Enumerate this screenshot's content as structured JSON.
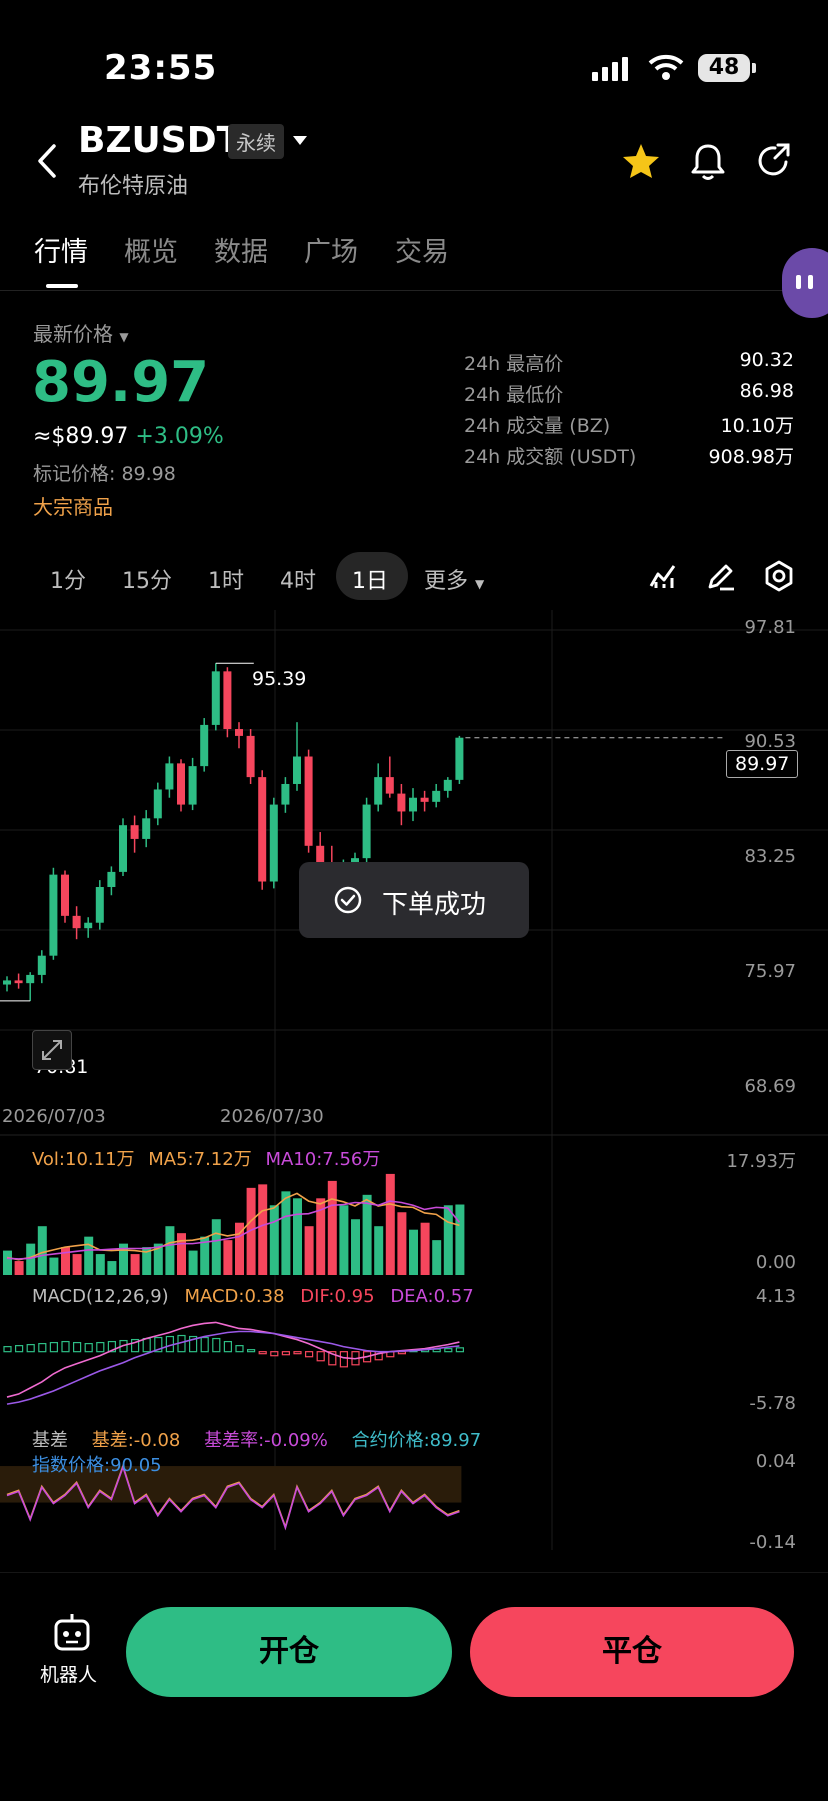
{
  "status_bar": {
    "time": "23:55",
    "battery": "48"
  },
  "header": {
    "symbol": "BZUSDT",
    "contract_type": "永续",
    "name": "布伦特原油"
  },
  "tabs": [
    "行情",
    "概览",
    "数据",
    "广场",
    "交易"
  ],
  "ticker": {
    "price_label": "最新价格",
    "last_price": "89.97",
    "usd_price": "≈$89.97",
    "change": "+3.09%",
    "mark_price": "标记价格: 89.98",
    "category": "大宗商品",
    "stats": [
      {
        "label": "24h 最高价",
        "value": "90.32"
      },
      {
        "label": "24h 最低价",
        "value": "86.98"
      },
      {
        "label": "24h 成交量 (BZ)",
        "value": "10.10万"
      },
      {
        "label": "24h 成交额 (USDT)",
        "value": "908.98万"
      }
    ]
  },
  "intervals": [
    "1分",
    "15分",
    "1时",
    "4时",
    "1日",
    "更多"
  ],
  "chart": {
    "y_ticks": [
      "97.81",
      "90.53",
      "83.25",
      "75.97",
      "68.69"
    ],
    "high_label": "95.39",
    "low_label": "70.81",
    "current_price_tag": "89.97",
    "x_labels": [
      "2026/07/03",
      "2026/07/30"
    ]
  },
  "volume": {
    "vol": "Vol:10.11万",
    "ma5": "MA5:7.12万",
    "ma10": "MA10:7.56万",
    "max": "17.93万",
    "min": "0.00"
  },
  "macd": {
    "title": "MACD(12,26,9)",
    "macd": "MACD:0.38",
    "dif": "DIF:0.95",
    "dea": "DEA:0.57",
    "max": "4.13",
    "min": "-5.78"
  },
  "basis": {
    "title": "基差",
    "basis": "基差:-0.08",
    "rate": "基差率:-0.09%",
    "contract": "合约价格:89.97",
    "index": "指数价格:90.05",
    "max": "0.04",
    "min": "-0.14"
  },
  "toast": "下单成功",
  "bottom": {
    "robot": "机器人",
    "open": "开仓",
    "close": "平仓"
  },
  "colors": {
    "up": "#2ebd85",
    "down": "#f6465d",
    "bg": "#000000"
  },
  "chart_data": {
    "type": "candlestick",
    "ylim": [
      68.69,
      97.81
    ],
    "high": 95.39,
    "low": 70.81,
    "last": 89.97,
    "candles": [
      [
        72.0,
        72.6,
        71.5,
        72.3
      ],
      [
        72.3,
        72.8,
        71.7,
        72.1
      ],
      [
        72.1,
        72.9,
        70.81,
        72.7
      ],
      [
        72.7,
        74.5,
        72.1,
        74.1
      ],
      [
        74.1,
        80.5,
        73.8,
        80.0
      ],
      [
        80.0,
        80.3,
        76.5,
        77.0
      ],
      [
        77.0,
        77.7,
        75.3,
        76.1
      ],
      [
        76.1,
        76.9,
        75.4,
        76.5
      ],
      [
        76.5,
        79.6,
        76.0,
        79.1
      ],
      [
        79.1,
        80.6,
        78.5,
        80.2
      ],
      [
        80.2,
        84.1,
        79.9,
        83.6
      ],
      [
        83.6,
        84.3,
        81.6,
        82.6
      ],
      [
        82.6,
        84.7,
        82.0,
        84.1
      ],
      [
        84.1,
        86.7,
        83.6,
        86.2
      ],
      [
        86.2,
        88.6,
        85.6,
        88.1
      ],
      [
        88.1,
        88.4,
        84.6,
        85.1
      ],
      [
        85.1,
        88.5,
        84.7,
        87.9
      ],
      [
        87.9,
        91.4,
        87.5,
        90.9
      ],
      [
        90.9,
        95.39,
        90.5,
        94.8
      ],
      [
        94.8,
        95.1,
        90.0,
        90.6
      ],
      [
        90.6,
        91.1,
        89.2,
        90.1
      ],
      [
        90.1,
        90.6,
        86.6,
        87.1
      ],
      [
        87.1,
        87.6,
        78.9,
        79.5
      ],
      [
        79.5,
        85.6,
        79.0,
        85.1
      ],
      [
        85.1,
        87.1,
        84.5,
        86.6
      ],
      [
        86.6,
        91.1,
        86.1,
        88.6
      ],
      [
        88.6,
        89.1,
        81.6,
        82.1
      ],
      [
        82.1,
        83.1,
        80.1,
        80.6
      ],
      [
        80.6,
        82.1,
        77.6,
        78.2
      ],
      [
        78.2,
        81.1,
        77.9,
        80.6
      ],
      [
        80.6,
        81.6,
        80.1,
        81.2
      ],
      [
        81.2,
        85.6,
        80.9,
        85.1
      ],
      [
        85.1,
        88.1,
        84.6,
        87.1
      ],
      [
        87.1,
        88.6,
        85.6,
        85.9
      ],
      [
        85.9,
        86.6,
        83.6,
        84.6
      ],
      [
        84.6,
        86.3,
        83.9,
        85.6
      ],
      [
        85.6,
        86.1,
        84.6,
        85.3
      ],
      [
        85.3,
        86.6,
        84.9,
        86.1
      ],
      [
        86.1,
        87.1,
        85.6,
        86.9
      ],
      [
        86.9,
        90.1,
        86.6,
        89.97
      ]
    ],
    "volume": [
      3.5,
      2.0,
      4.5,
      7.0,
      2.5,
      4.0,
      3.0,
      5.5,
      3.0,
      2.0,
      4.5,
      3.0,
      4.0,
      4.5,
      7.0,
      6.0,
      3.5,
      5.5,
      8.0,
      5.0,
      7.5,
      12.5,
      13.0,
      10.0,
      12.0,
      11.0,
      7.0,
      11.0,
      13.5,
      10.0,
      8.0,
      11.5,
      7.0,
      14.5,
      9.0,
      6.5,
      7.5,
      5.0,
      10.0,
      10.11
    ],
    "ma5": [
      2.5,
      2.2,
      2.5,
      3.2,
      3.6,
      4.0,
      4.2,
      4.4,
      3.6,
      3.5,
      3.6,
      3.5,
      3.3,
      3.8,
      4.6,
      4.9,
      5.0,
      5.3,
      6.0,
      5.6,
      5.9,
      7.7,
      9.2,
      9.6,
      11.0,
      11.7,
      10.6,
      10.2,
      10.9,
      10.5,
      9.9,
      10.8,
      9.9,
      10.2,
      9.8,
      9.7,
      8.9,
      8.7,
      7.6,
      7.12
    ],
    "ma10": [
      2.4,
      2.3,
      2.4,
      2.8,
      3.0,
      3.2,
      3.4,
      3.6,
      3.6,
      3.7,
      3.8,
      3.8,
      3.8,
      4.0,
      4.3,
      4.5,
      4.5,
      4.7,
      4.9,
      5.2,
      5.5,
      6.4,
      7.1,
      7.6,
      8.4,
      8.7,
      8.8,
      9.3,
      10.0,
      10.1,
      10.4,
      10.3,
      10.0,
      10.6,
      10.4,
      10.0,
      9.4,
      9.7,
      9.6,
      7.56
    ],
    "macd_hist": [
      0.5,
      0.6,
      0.7,
      0.8,
      0.9,
      1.0,
      0.9,
      0.8,
      0.9,
      1.0,
      1.1,
      1.2,
      1.3,
      1.4,
      1.5,
      1.6,
      1.5,
      1.4,
      1.3,
      1.0,
      0.6,
      0.2,
      -0.2,
      -0.4,
      -0.3,
      -0.2,
      -0.5,
      -0.9,
      -1.3,
      -1.5,
      -1.3,
      -1.0,
      -0.8,
      -0.5,
      -0.2,
      0.1,
      0.2,
      0.25,
      0.3,
      0.38
    ],
    "dif": [
      -4.5,
      -4.2,
      -3.6,
      -3.0,
      -2.2,
      -1.6,
      -1.2,
      -0.8,
      -0.4,
      0.1,
      0.6,
      0.9,
      1.3,
      1.6,
      1.9,
      2.3,
      2.6,
      2.8,
      2.9,
      2.6,
      2.3,
      2.2,
      2.0,
      1.8,
      1.5,
      1.2,
      0.8,
      0.3,
      -0.2,
      -0.6,
      -0.7,
      -0.5,
      -0.2,
      0.0,
      0.1,
      0.2,
      0.3,
      0.5,
      0.7,
      0.95
    ],
    "dea": [
      -5.2,
      -5.0,
      -4.7,
      -4.3,
      -3.9,
      -3.4,
      -2.9,
      -2.4,
      -1.9,
      -1.5,
      -1.1,
      -0.6,
      -0.2,
      0.2,
      0.6,
      0.9,
      1.2,
      1.5,
      1.7,
      1.9,
      2.0,
      2.0,
      1.9,
      1.8,
      1.6,
      1.4,
      1.2,
      1.0,
      0.8,
      0.5,
      0.3,
      0.1,
      0.0,
      0.0,
      0.05,
      0.1,
      0.2,
      0.3,
      0.45,
      0.57
    ],
    "basis_rate": [
      -0.04,
      -0.03,
      -0.1,
      -0.02,
      -0.06,
      -0.04,
      -0.01,
      -0.07,
      -0.03,
      -0.05,
      0.03,
      -0.06,
      -0.04,
      -0.09,
      -0.05,
      -0.08,
      -0.05,
      -0.04,
      -0.07,
      -0.02,
      -0.01,
      -0.05,
      -0.07,
      -0.04,
      -0.12,
      -0.02,
      -0.08,
      -0.06,
      -0.03,
      -0.09,
      -0.05,
      -0.04,
      -0.02,
      -0.08,
      -0.03,
      -0.06,
      -0.04,
      -0.07,
      -0.09,
      -0.08
    ]
  }
}
